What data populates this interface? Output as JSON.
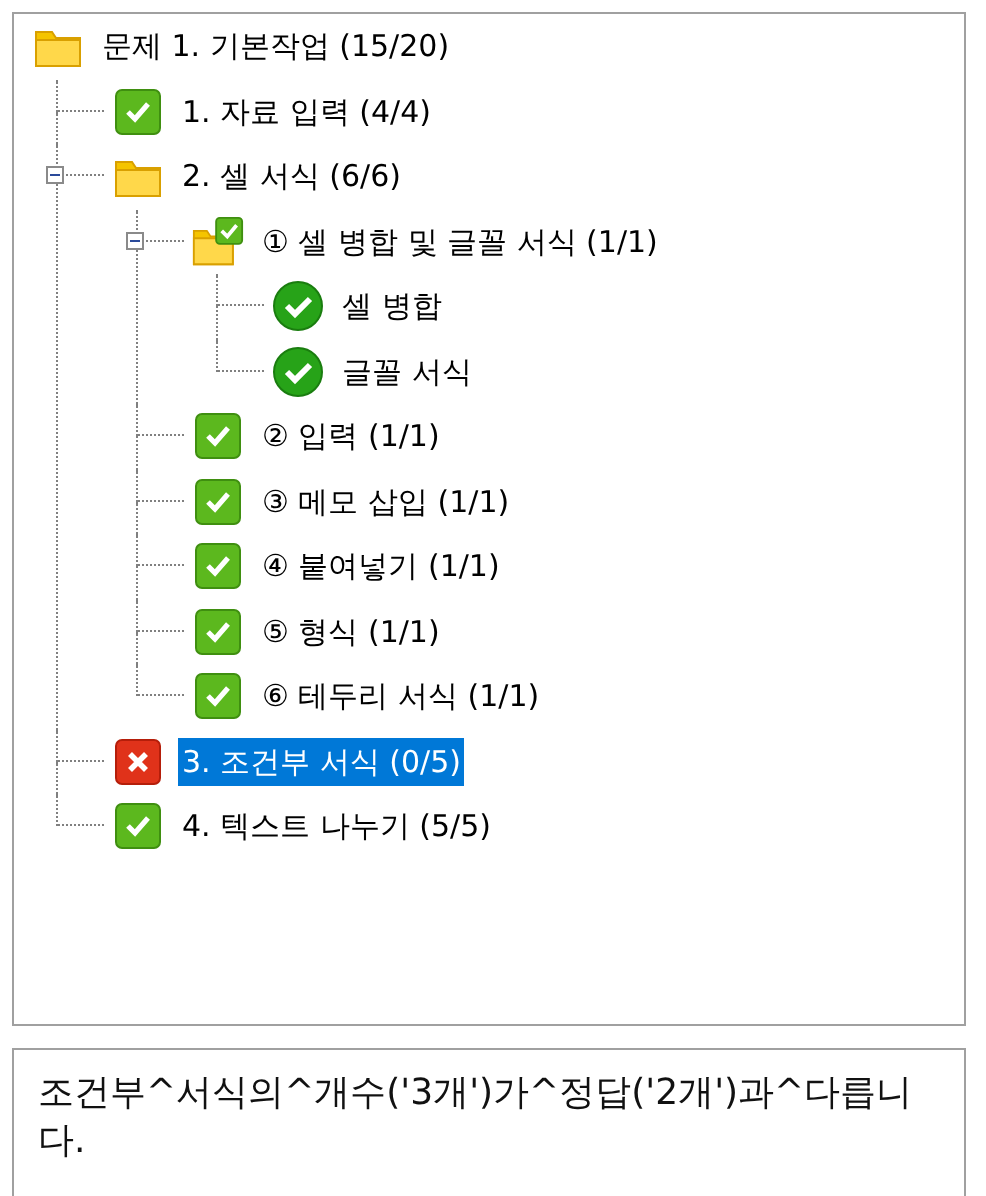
{
  "tree": {
    "nodes": [
      {
        "label": "문제 1. 기본작업 (15/20)",
        "kind": "folder",
        "selected": false,
        "children": [
          {
            "label": "1. 자료 입력 (4/4)",
            "kind": "check",
            "selected": false
          },
          {
            "label": "2. 셀 서식 (6/6)",
            "kind": "folder",
            "selected": false,
            "expanded": true,
            "children": [
              {
                "label": "① 셀 병합 및 글꼴 서식 (1/1)",
                "kind": "folder-check",
                "selected": false,
                "expanded": true,
                "children": [
                  {
                    "label": "셀 병합",
                    "kind": "circle-check",
                    "selected": false
                  },
                  {
                    "label": "글꼴 서식",
                    "kind": "circle-check",
                    "selected": false
                  }
                ]
              },
              {
                "label": "② 입력 (1/1)",
                "kind": "check",
                "selected": false
              },
              {
                "label": "③ 메모 삽입 (1/1)",
                "kind": "check",
                "selected": false
              },
              {
                "label": "④ 붙여넣기 (1/1)",
                "kind": "check",
                "selected": false
              },
              {
                "label": "⑤ 형식 (1/1)",
                "kind": "check",
                "selected": false
              },
              {
                "label": "⑥ 테두리 서식 (1/1)",
                "kind": "check",
                "selected": false
              }
            ]
          },
          {
            "label": "3. 조건부 서식 (0/5)",
            "kind": "cross",
            "selected": true
          },
          {
            "label": "4. 텍스트 나누기 (5/5)",
            "kind": "check",
            "selected": false
          }
        ]
      }
    ]
  },
  "message": {
    "text": "조건부^서식의^개수('3개')가^정답('2개')과^다릅니다."
  }
}
